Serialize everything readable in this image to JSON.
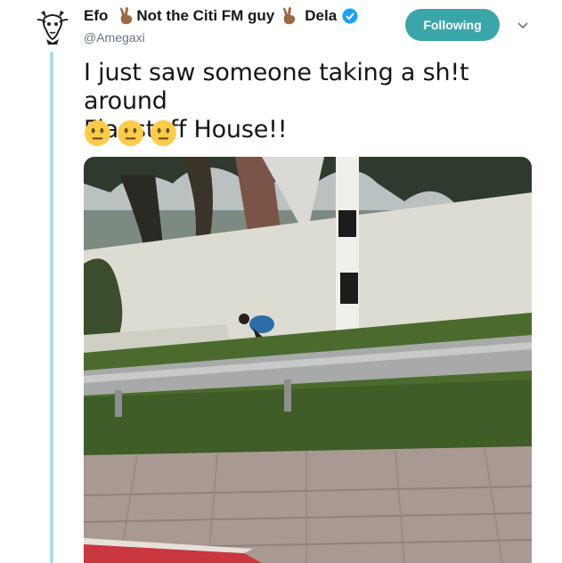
{
  "tweet": {
    "display_name_part1": "Efo",
    "display_name_part2": "Not the Citi FM guy",
    "display_name_part3": "Dela",
    "handle": "@Amegaxi",
    "text_line1": "I just saw someone taking a sh!t around",
    "text_line2": "Flagstaff House!!",
    "reaction_emojis": [
      "neutral-face",
      "neutral-face",
      "neutral-face"
    ]
  },
  "actions": {
    "follow_label": "Following",
    "more_icon": "chevron-down-icon"
  },
  "colors": {
    "follow_button": "#3aa6a9",
    "thread_line": "#a8dde9",
    "verified_badge": "#1da1f2",
    "handle_text": "#657786"
  },
  "media": {
    "description_icon": "photo"
  }
}
